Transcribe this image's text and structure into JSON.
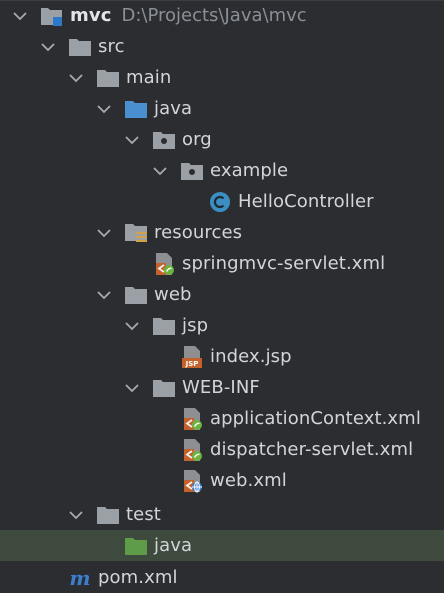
{
  "project": {
    "name": "mvc",
    "path": "D:\\Projects\\Java\\mvc"
  },
  "tree": {
    "src": "src",
    "main": "main",
    "java": "java",
    "org": "org",
    "example": "example",
    "hello_controller": "HelloController",
    "resources": "resources",
    "springmvc_servlet": "springmvc-servlet.xml",
    "web": "web",
    "jsp": "jsp",
    "index_jsp": "index.jsp",
    "web_inf": "WEB-INF",
    "application_context": "applicationContext.xml",
    "dispatcher_servlet": "dispatcher-servlet.xml",
    "web_xml": "web.xml",
    "test": "test",
    "test_java": "java",
    "pom": "pom.xml"
  },
  "colors": {
    "background": "#2b2d30",
    "selected_row": "#3d4a3d",
    "folder_gray": "#9aa0a6",
    "source_folder_blue": "#4a8fcf",
    "test_folder_green": "#5e9c48",
    "class_badge": "#3c8fc2",
    "xml_orange": "#c4622b",
    "maven_blue": "#3c7fd0"
  }
}
